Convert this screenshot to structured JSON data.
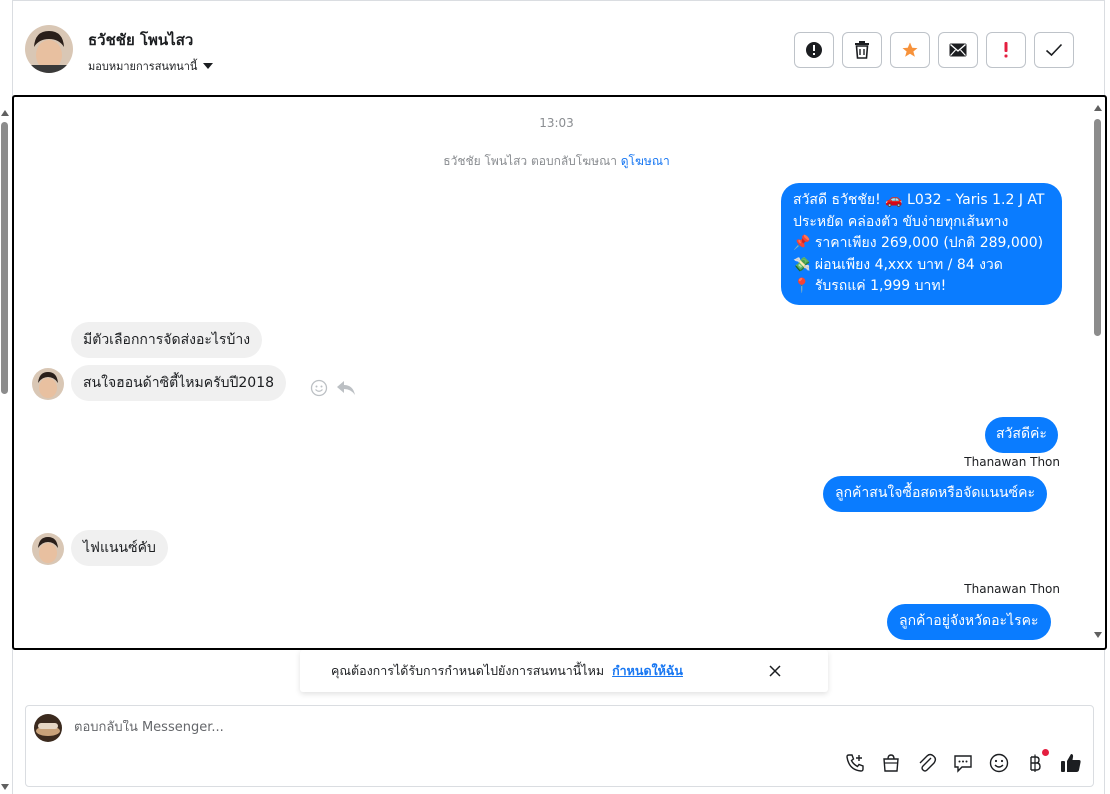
{
  "header": {
    "contact_name": "ธวัชชัย โพนไสว",
    "assign_label": "มอบหมายการสนทนานี้",
    "actions": [
      {
        "name": "alert-icon-button",
        "icon": "exclamation-circle-icon"
      },
      {
        "name": "delete-button",
        "icon": "trash-icon"
      },
      {
        "name": "star-button",
        "icon": "star-icon",
        "color": "#f7923b"
      },
      {
        "name": "mail-button",
        "icon": "envelope-icon"
      },
      {
        "name": "priority-button",
        "icon": "exclamation-icon",
        "color": "#e41e3f"
      },
      {
        "name": "done-button",
        "icon": "check-icon"
      }
    ]
  },
  "chat": {
    "timestamp": "13:03",
    "ad_note": "ธวัชชัย โพนไสว ตอบกลับโฆษณา",
    "ad_link": "ดูโฆษณา",
    "ad_message_lines": [
      "สวัสดี ธวัชชัย! 🚗 L032 - Yaris 1.2 J AT",
      "ประหยัด คล่องตัว ขับง่ายทุกเส้นทาง",
      "📌 ราคาเพียง 269,000 (ปกติ 289,000)",
      "💸 ผ่อนเพียง 4,xxx บาท / 84 งวด",
      "📍 รับรถแค่ 1,999 บาท!"
    ],
    "incoming_1": "มีตัวเลือกการจัดส่งอะไรบ้าง",
    "incoming_2": "สนใจฮอนด้าซิตี้ไหมครับปี2018",
    "outgoing_greeting": "สวัสดีค่ะ",
    "agent_name_1": "Thanawan Thon",
    "outgoing_question_1": "ลูกค้าสนใจซื้อสดหรือจัดแนนซ์คะ",
    "incoming_3": "ไฟแนนซ์คับ",
    "agent_name_2": "Thanawan Thon",
    "outgoing_question_2": "ลูกค้าอยู่จังหวัดอะไรคะ"
  },
  "banner": {
    "text": "คุณต้องการได้รับการกำหนดไปยังการสนทนานี้ไหม",
    "link": "กำหนดให้ฉัน"
  },
  "composer": {
    "placeholder": "ตอบกลับใน Messenger...",
    "tools": [
      "phone-add-icon",
      "shopping-bag-icon",
      "paperclip-icon",
      "chat-bubble-icon",
      "emoji-icon",
      "baht-icon",
      "thumbs-up-icon"
    ]
  },
  "colors": {
    "outgoing_bubble": "#0a7cff",
    "incoming_bubble": "#f0f0f0",
    "link": "#1877f2",
    "star": "#f7923b",
    "priority": "#e41e3f"
  }
}
